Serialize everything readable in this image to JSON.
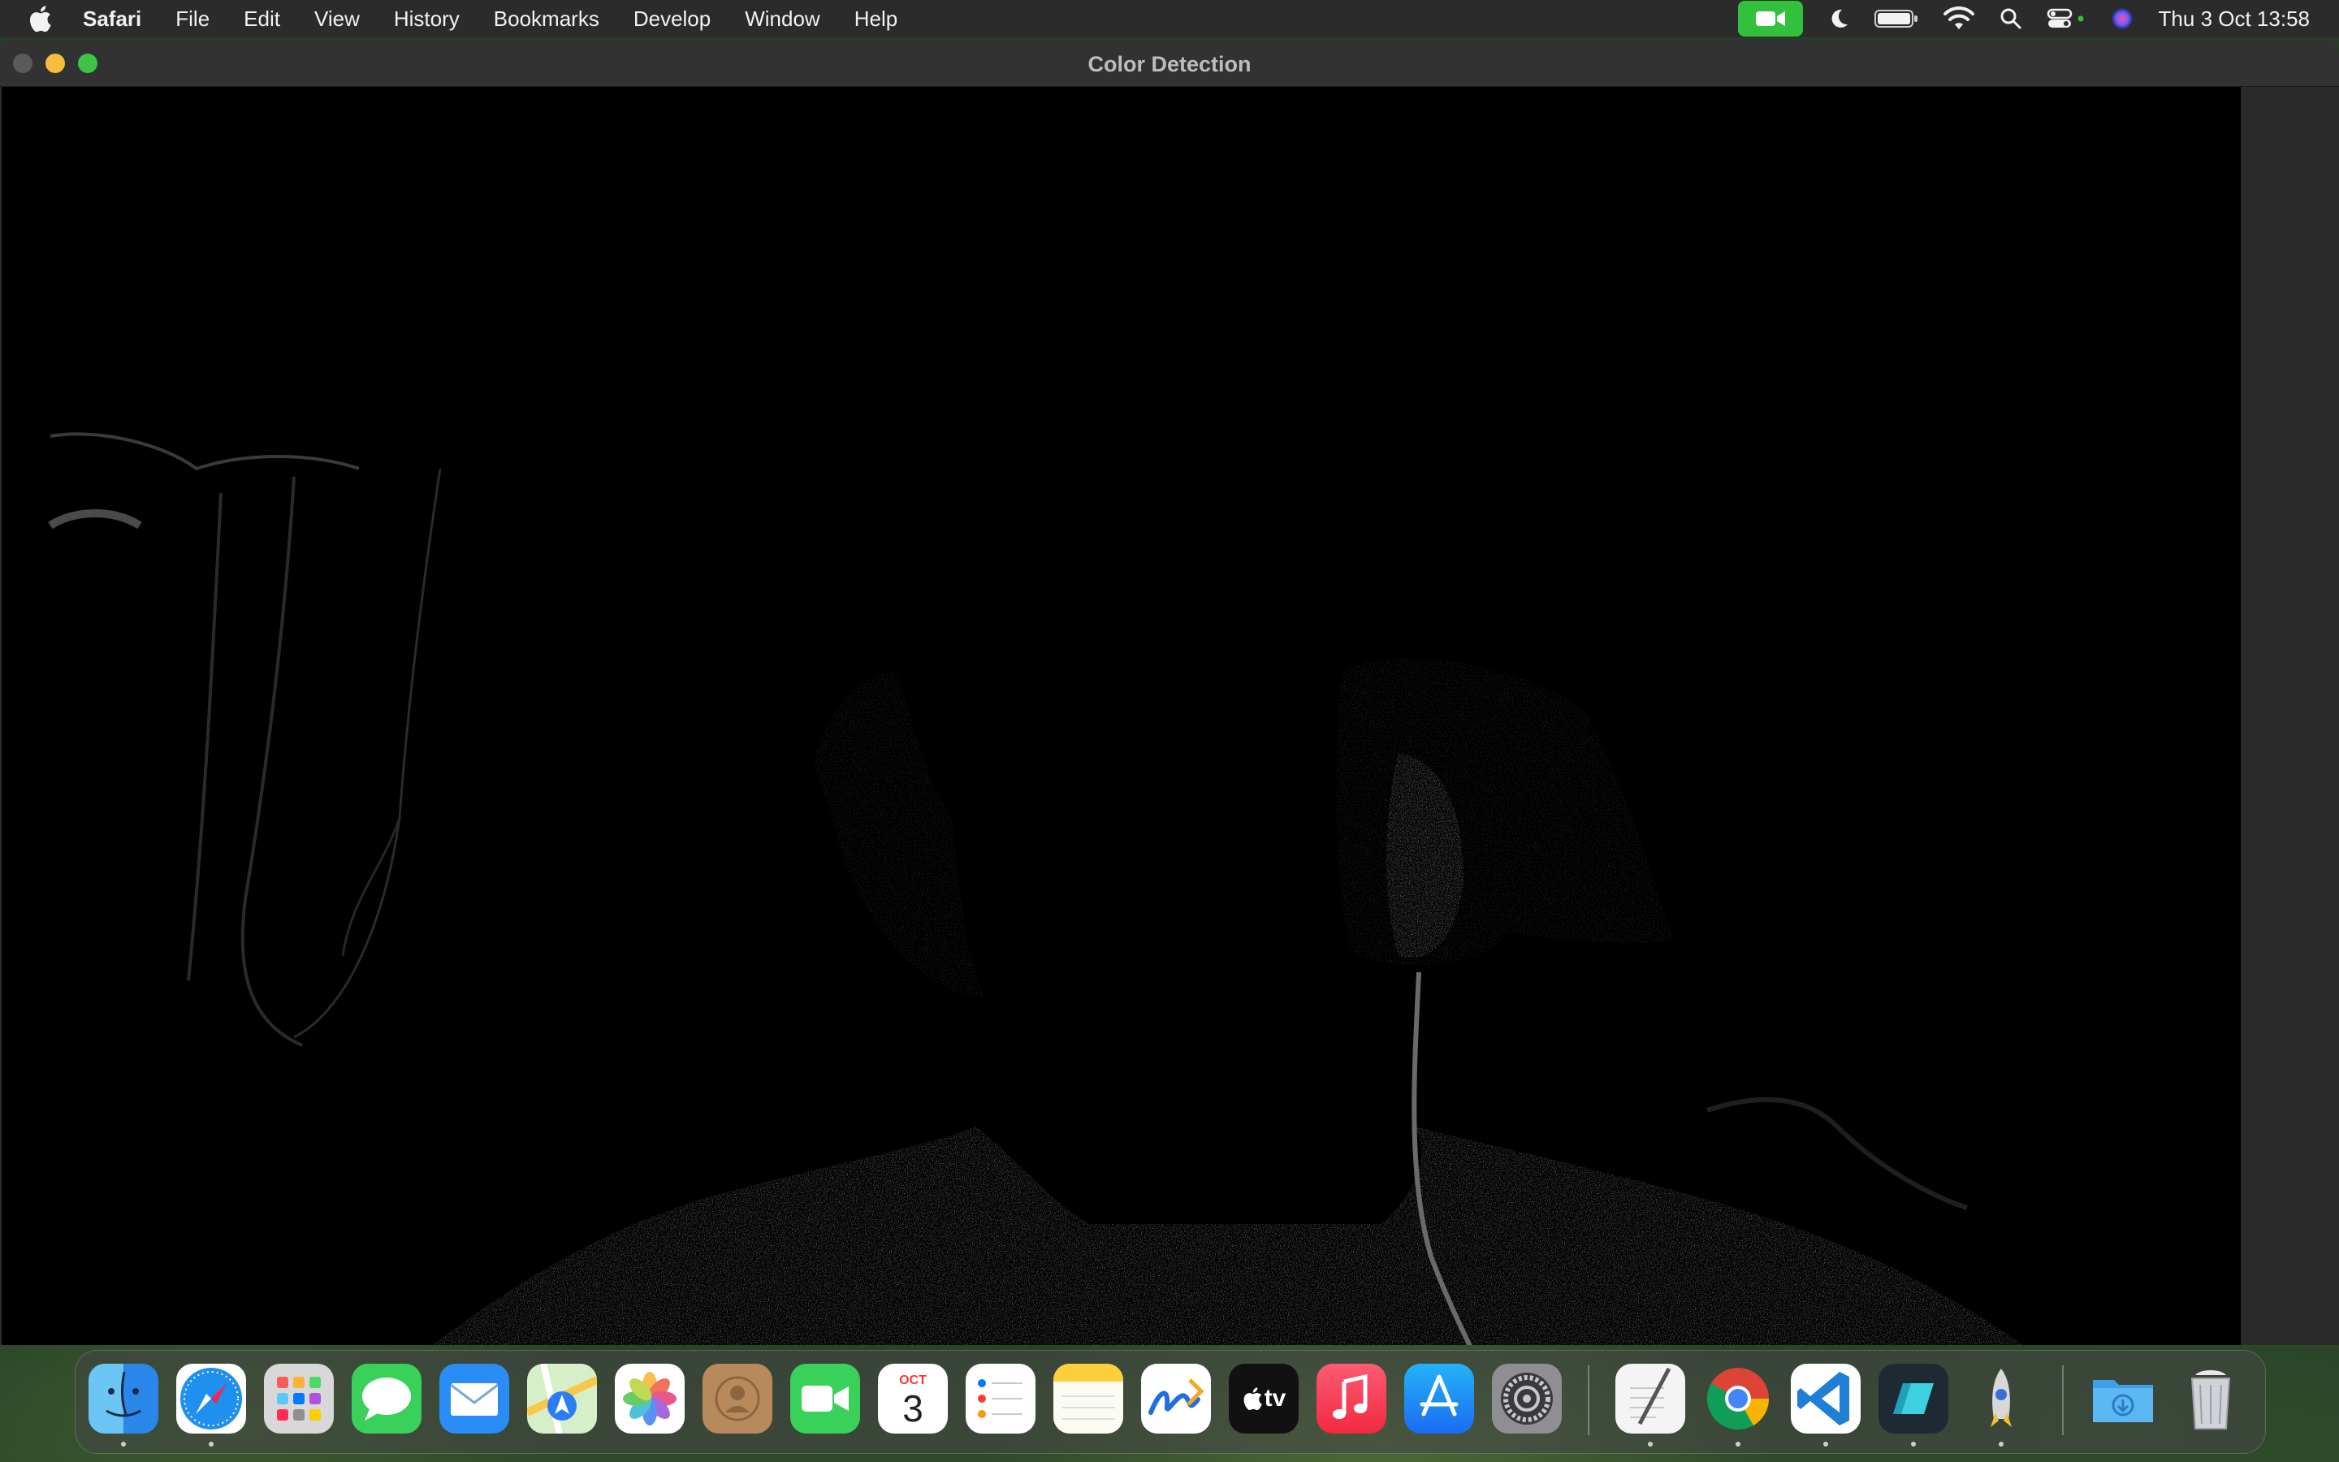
{
  "menubar": {
    "app_name": "Safari",
    "items": [
      "File",
      "Edit",
      "View",
      "History",
      "Bookmarks",
      "Develop",
      "Window",
      "Help"
    ],
    "clock": "Thu 3 Oct  13:58"
  },
  "window": {
    "title": "Color Detection"
  },
  "dock": {
    "calendar_month": "OCT",
    "calendar_day": "3",
    "tv_label": "tv",
    "apps": [
      {
        "name": "Finder",
        "running": true
      },
      {
        "name": "Safari",
        "running": true
      },
      {
        "name": "Launchpad",
        "running": false
      },
      {
        "name": "Messages",
        "running": false
      },
      {
        "name": "Mail",
        "running": false
      },
      {
        "name": "Maps",
        "running": false
      },
      {
        "name": "Photos",
        "running": false
      },
      {
        "name": "Contacts",
        "running": false
      },
      {
        "name": "FaceTime",
        "running": false
      },
      {
        "name": "Calendar",
        "running": false
      },
      {
        "name": "Reminders",
        "running": false
      },
      {
        "name": "Notes",
        "running": false
      },
      {
        "name": "Freeform",
        "running": false
      },
      {
        "name": "TV",
        "running": false
      },
      {
        "name": "Music",
        "running": false
      },
      {
        "name": "App Store",
        "running": false
      },
      {
        "name": "System Settings",
        "running": false
      },
      {
        "name": "TextEdit",
        "running": true
      },
      {
        "name": "Chrome",
        "running": true
      },
      {
        "name": "VS Code",
        "running": true
      },
      {
        "name": "Pen Tool App",
        "running": true
      },
      {
        "name": "Python Launcher",
        "running": true
      },
      {
        "name": "Downloads",
        "running": false
      },
      {
        "name": "Trash",
        "running": false
      }
    ]
  },
  "colors": {
    "facetime_indicator": "#33c13d",
    "close": "#5a5a5a",
    "minimize": "#f5bd3f",
    "maximize": "#3fc24a"
  }
}
